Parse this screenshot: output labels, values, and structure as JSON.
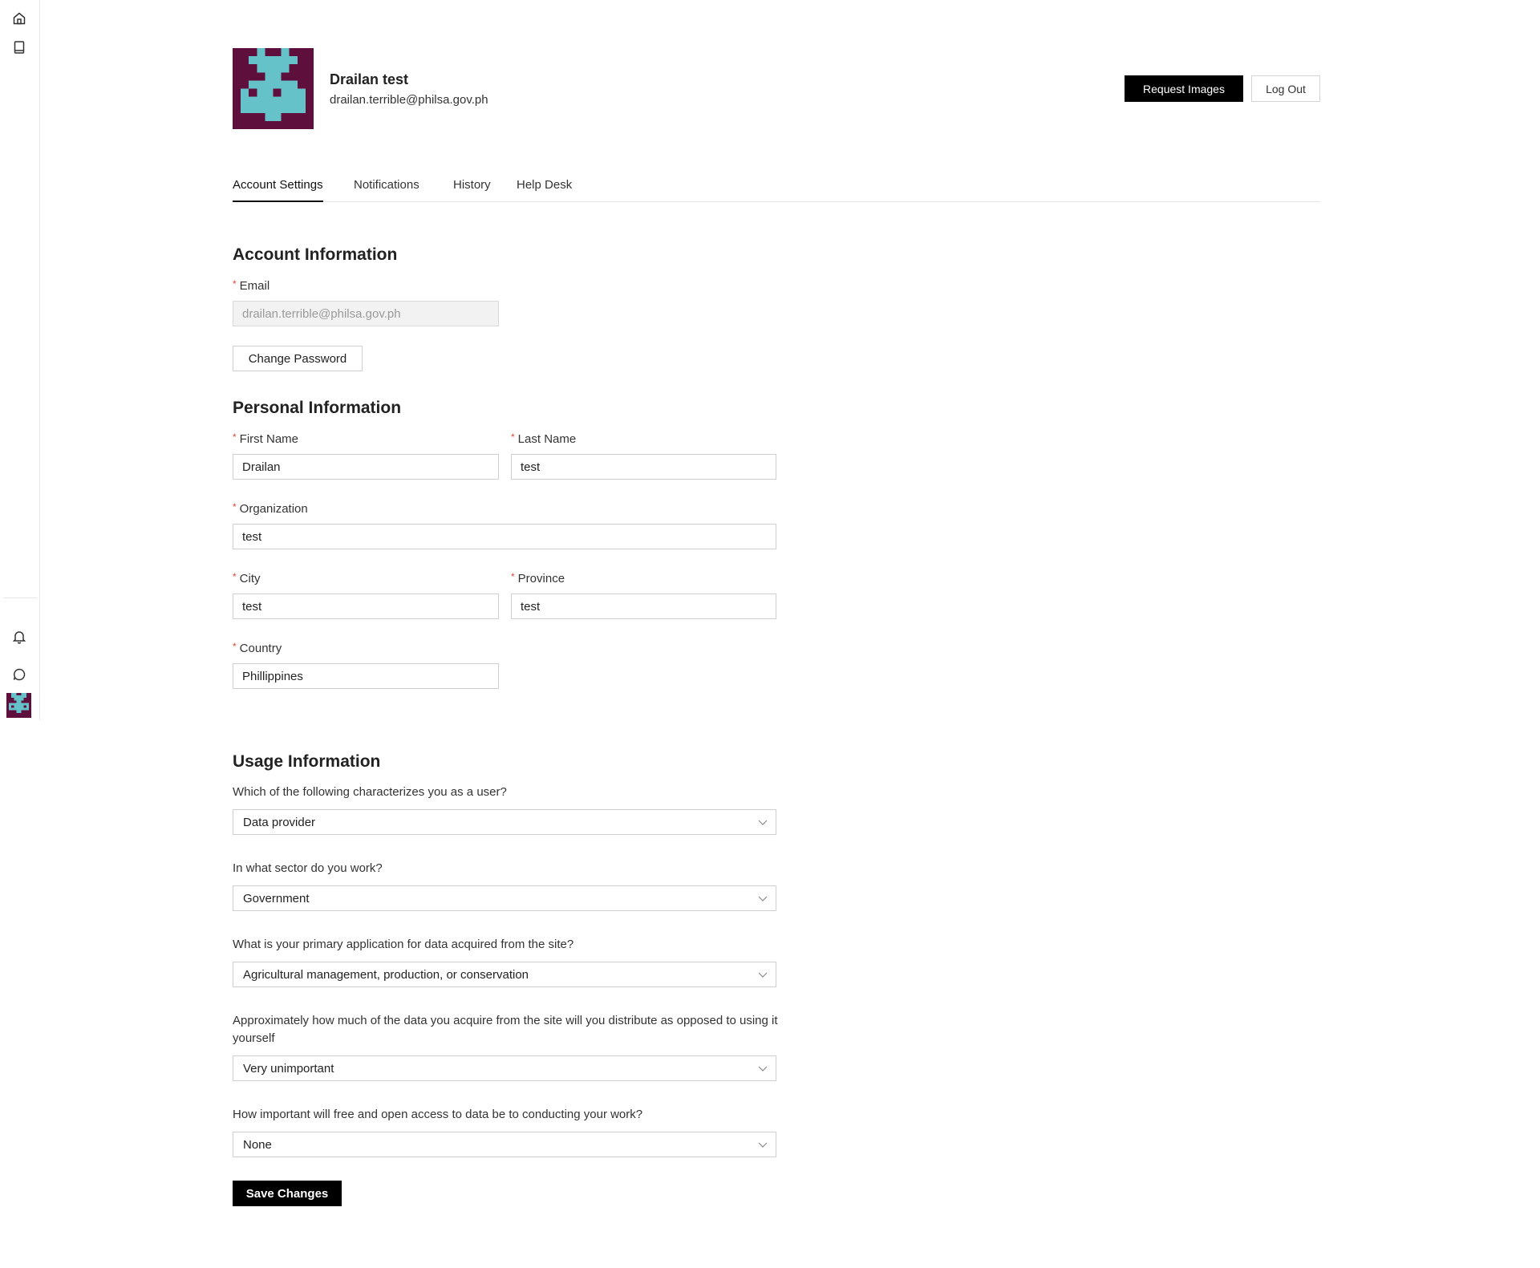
{
  "profile": {
    "name": "Drailan test",
    "email": "drailan.terrible@philsa.gov.ph",
    "avatar_colors": {
      "background": "#5e0f3c",
      "foreground": "#66c2c9"
    }
  },
  "header": {
    "request_images_label": "Request Images",
    "logout_label": "Log Out"
  },
  "rail": {
    "icons": [
      "home-icon",
      "book-icon",
      "bell-icon",
      "chat-icon"
    ]
  },
  "tabs": [
    {
      "label": "Account Settings",
      "active": true
    },
    {
      "label": "Notifications",
      "active": false
    },
    {
      "label": "History",
      "active": false
    },
    {
      "label": "Help Desk",
      "active": false
    }
  ],
  "account": {
    "title": "Account Information",
    "email_label": "Email",
    "email_value": "drailan.terrible@philsa.gov.ph",
    "change_password_label": "Change Password"
  },
  "personal": {
    "title": "Personal Information",
    "first_name_label": "First Name",
    "first_name_value": "Drailan",
    "last_name_label": "Last Name",
    "last_name_value": "test",
    "organization_label": "Organization",
    "organization_value": "test",
    "city_label": "City",
    "city_value": "test",
    "province_label": "Province",
    "province_value": "test",
    "country_label": "Country",
    "country_value": "Phillippines"
  },
  "usage": {
    "title": "Usage Information",
    "questions": [
      {
        "question": "Which of the following characterizes you as a user?",
        "answer": "Data provider"
      },
      {
        "question": "In what sector do you work?",
        "answer": "Government"
      },
      {
        "question": "What is your primary application for data acquired from the site?",
        "answer": "Agricultural management, production, or conservation"
      },
      {
        "question": "Approximately how much of the data you acquire from the site will you distribute as opposed to using it yourself",
        "answer": "Very unimportant"
      },
      {
        "question": "How important will free and open access to data be to conducting your work?",
        "answer": "None"
      }
    ]
  },
  "save_label": "Save Changes",
  "required_marker": "*"
}
